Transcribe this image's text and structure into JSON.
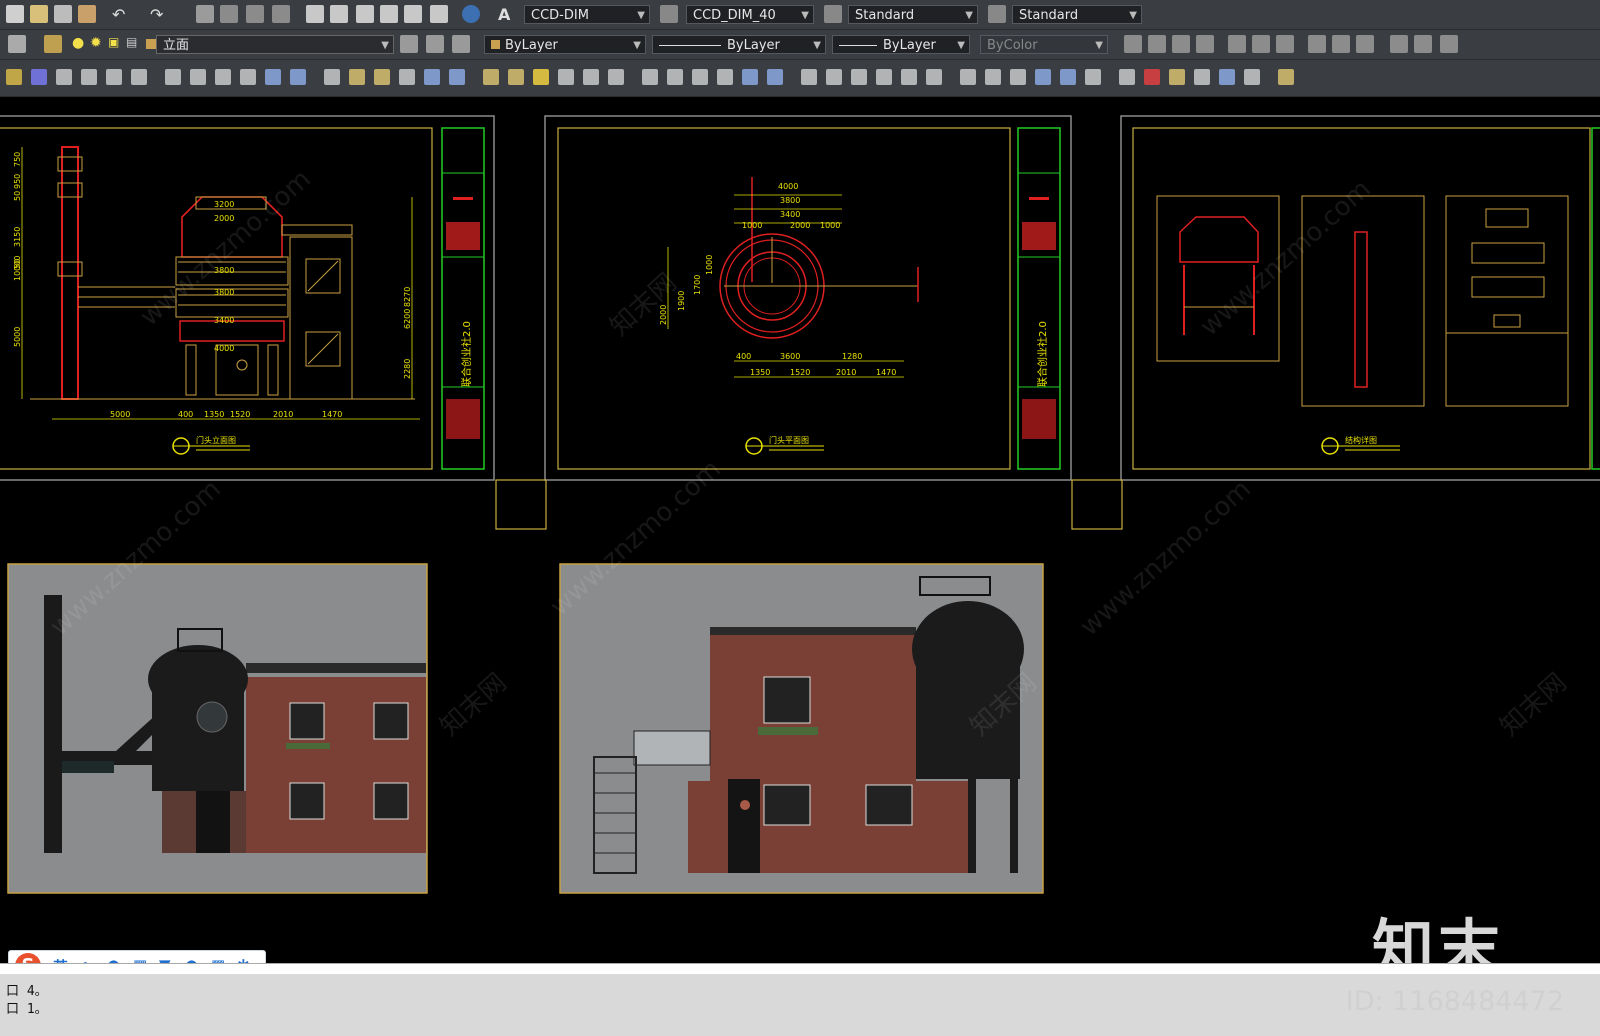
{
  "toolbar": {
    "textstyle": "CCD-DIM",
    "dimstyle": "CCD_DIM_40",
    "tablestyle": "Standard",
    "mleaderstyle": "Standard",
    "layer": "立面",
    "color": "ByLayer",
    "linetype": "ByLayer",
    "lineweight": "ByLayer",
    "plotstyle": "ByColor"
  },
  "watermark": {
    "site": "www.znzmo.com",
    "cn": "知末网"
  },
  "drawings": {
    "elev_title": "门头立面图",
    "plan_title": "门头平面图",
    "detail_title": "结构详图",
    "project_name": "联合创业社2.0",
    "dims_elev_bottom": [
      "5000",
      "400",
      "1350",
      "1520",
      "2010",
      "1470"
    ],
    "dims_elev_left": [
      "750",
      "950",
      "50",
      "3150",
      "50",
      "10000",
      "5000"
    ],
    "dims_elev_right": [
      "8270",
      "6200",
      "2280"
    ],
    "dims_elev_mid": [
      "3200",
      "2000",
      "3800",
      "3800",
      "3400",
      "4000"
    ],
    "dims_plan_top": [
      "4000",
      "3800",
      "3400",
      "2000",
      "1000",
      "1000"
    ],
    "dims_plan_bottom": [
      "400",
      "3600",
      "1280",
      "1350",
      "1520",
      "2010",
      "1470"
    ],
    "dims_plan_left": [
      "2000",
      "1900",
      "1700",
      "1000"
    ]
  },
  "ime": {
    "mode": "英"
  },
  "cmd": {
    "line1": "口 4。",
    "line2": "口 1。"
  },
  "brand": "知末",
  "id_text": "ID: 1168484472"
}
